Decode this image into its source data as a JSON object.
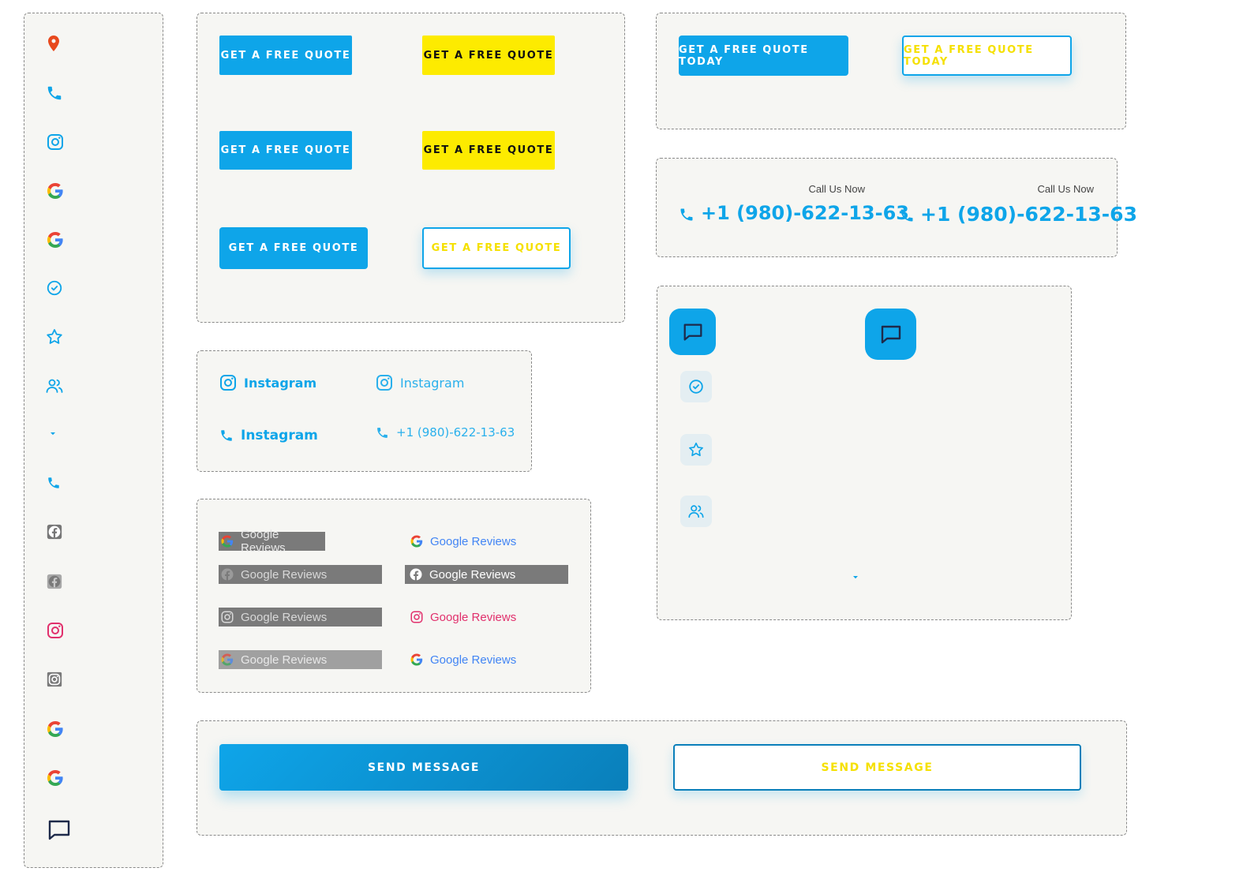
{
  "colors": {
    "primary_blue": "#0ea5e9",
    "yellow": "#fdeb00",
    "outline_text_yellow": "#f5e000",
    "instagram_pink": "#e1306c",
    "google_blue": "#4285f4",
    "navy": "#1e2a4a",
    "location_red": "#e8491d"
  },
  "sidebar": {
    "icons": [
      "location-pin-icon",
      "phone-icon",
      "instagram-icon",
      "google-icon",
      "google-icon",
      "check-circle-icon",
      "star-icon",
      "users-icon",
      "caret-down-icon",
      "phone-small-icon",
      "facebook-gray-icon",
      "facebook-gray-light-icon",
      "instagram-pink-icon",
      "instagram-gray-icon",
      "google-icon",
      "google-icon",
      "chat-bubble-icon"
    ]
  },
  "quote_buttons": {
    "label": "GET A FREE QUOTE"
  },
  "quote_today": {
    "label": "GET A FREE QUOTE TODAY"
  },
  "call": {
    "caption": "Call Us Now",
    "number": "+1 (980)-622-13-63"
  },
  "social_links": {
    "instagram_label": "Instagram",
    "phone_number": "+1 (980)-622-13-63"
  },
  "reviews": {
    "label": "Google Reviews"
  },
  "chat_panel": {
    "icons": [
      "chat-bubble-icon",
      "check-circle-icon",
      "star-icon",
      "users-icon",
      "caret-down-icon"
    ]
  },
  "send": {
    "label": "SEND MESSAGE"
  }
}
